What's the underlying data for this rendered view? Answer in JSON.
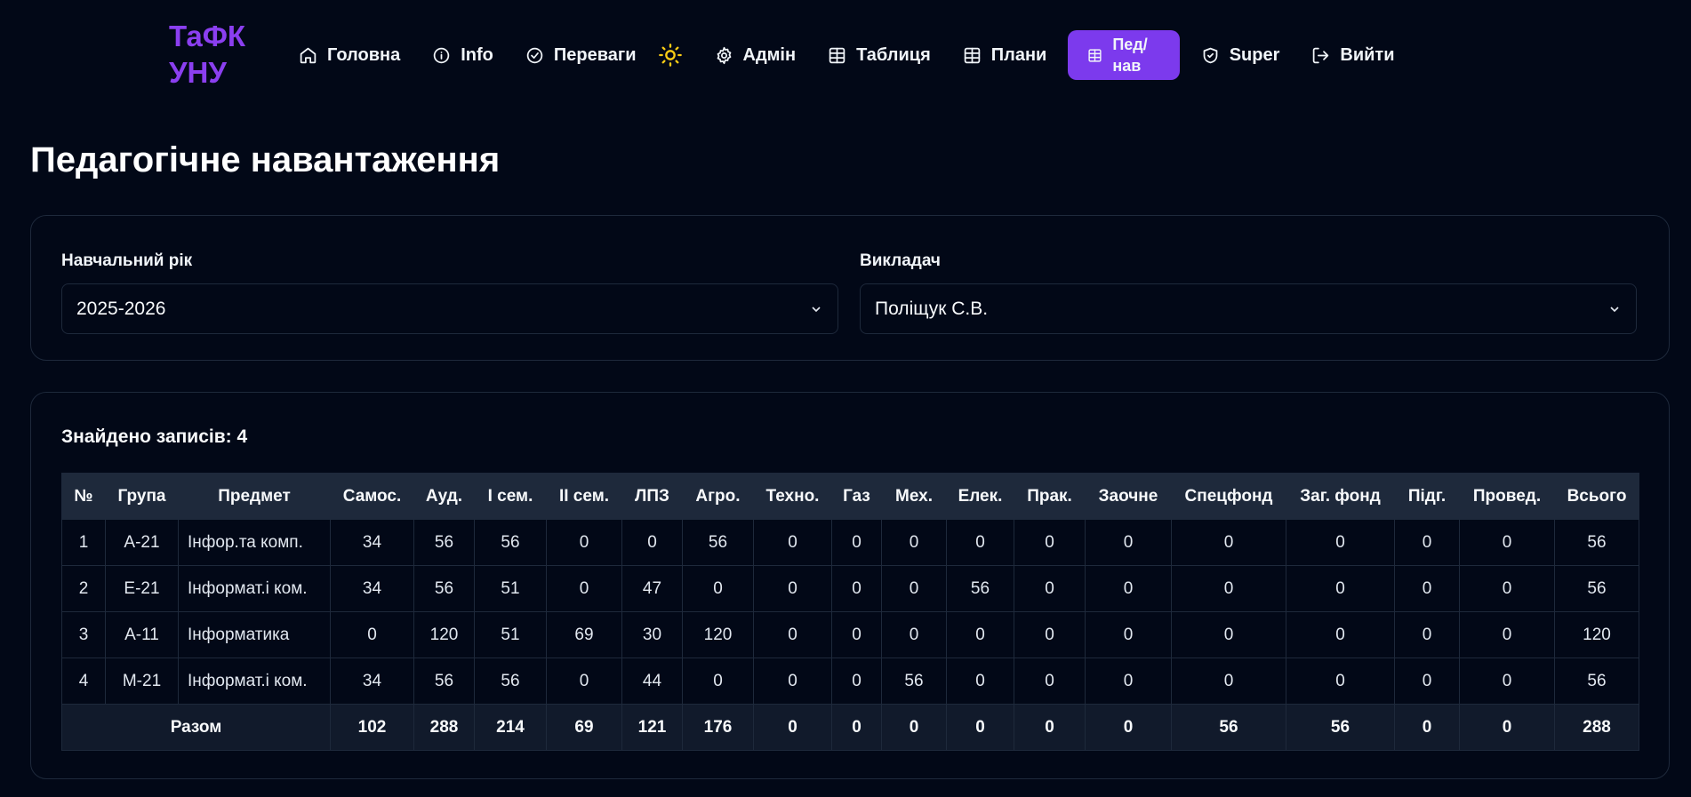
{
  "logo": "ТаФК УНУ",
  "nav": {
    "items": [
      {
        "label": "Головна",
        "icon": "home-icon"
      },
      {
        "label": "Info",
        "icon": "info-icon"
      },
      {
        "label": "Переваги",
        "icon": "check-circle-icon"
      },
      {
        "label": "Адмін",
        "icon": "gear-icon"
      },
      {
        "label": "Таблиця",
        "icon": "table-icon"
      },
      {
        "label": "Плани",
        "icon": "table-icon"
      },
      {
        "label": "Пед/\nнав",
        "icon": "table-icon",
        "active": true
      },
      {
        "label": "Super",
        "icon": "shield-icon"
      },
      {
        "label": "Вийти",
        "icon": "logout-icon"
      }
    ],
    "theme_icon": "sun-icon",
    "accent_color": "#7c3aed"
  },
  "page": {
    "title": "Педагогічне навантаження"
  },
  "filters": {
    "year_label": "Навчальний рік",
    "year_value": "2025-2026",
    "teacher_label": "Викладач",
    "teacher_value": "Поліщук С.В."
  },
  "results": {
    "count_text": "Знайдено записів: 4",
    "columns": [
      "№",
      "Група",
      "Предмет",
      "Самос.",
      "Ауд.",
      "І сем.",
      "ІІ сем.",
      "ЛПЗ",
      "Агро.",
      "Техно.",
      "Газ",
      "Мех.",
      "Елек.",
      "Прак.",
      "Заочне",
      "Спецфонд",
      "Заг. фонд",
      "Підг.",
      "Провед.",
      "Всього"
    ],
    "rows": [
      [
        "1",
        "А-21",
        "Інфор.та комп.",
        "34",
        "56",
        "56",
        "0",
        "0",
        "56",
        "0",
        "0",
        "0",
        "0",
        "0",
        "0",
        "0",
        "0",
        "0",
        "0",
        "56"
      ],
      [
        "2",
        "Е-21",
        "Інформат.і ком.",
        "34",
        "56",
        "51",
        "0",
        "47",
        "0",
        "0",
        "0",
        "0",
        "56",
        "0",
        "0",
        "0",
        "0",
        "0",
        "0",
        "56"
      ],
      [
        "3",
        "А-11",
        "Інформатика",
        "0",
        "120",
        "51",
        "69",
        "30",
        "120",
        "0",
        "0",
        "0",
        "0",
        "0",
        "0",
        "0",
        "0",
        "0",
        "0",
        "120"
      ],
      [
        "4",
        "М-21",
        "Інформат.і ком.",
        "34",
        "56",
        "56",
        "0",
        "44",
        "0",
        "0",
        "0",
        "56",
        "0",
        "0",
        "0",
        "0",
        "0",
        "0",
        "0",
        "56"
      ]
    ],
    "totals_label": "Разом",
    "totals": [
      "102",
      "288",
      "214",
      "69",
      "121",
      "176",
      "0",
      "0",
      "0",
      "0",
      "0",
      "0",
      "56",
      "56",
      "0",
      "0",
      "288"
    ]
  }
}
